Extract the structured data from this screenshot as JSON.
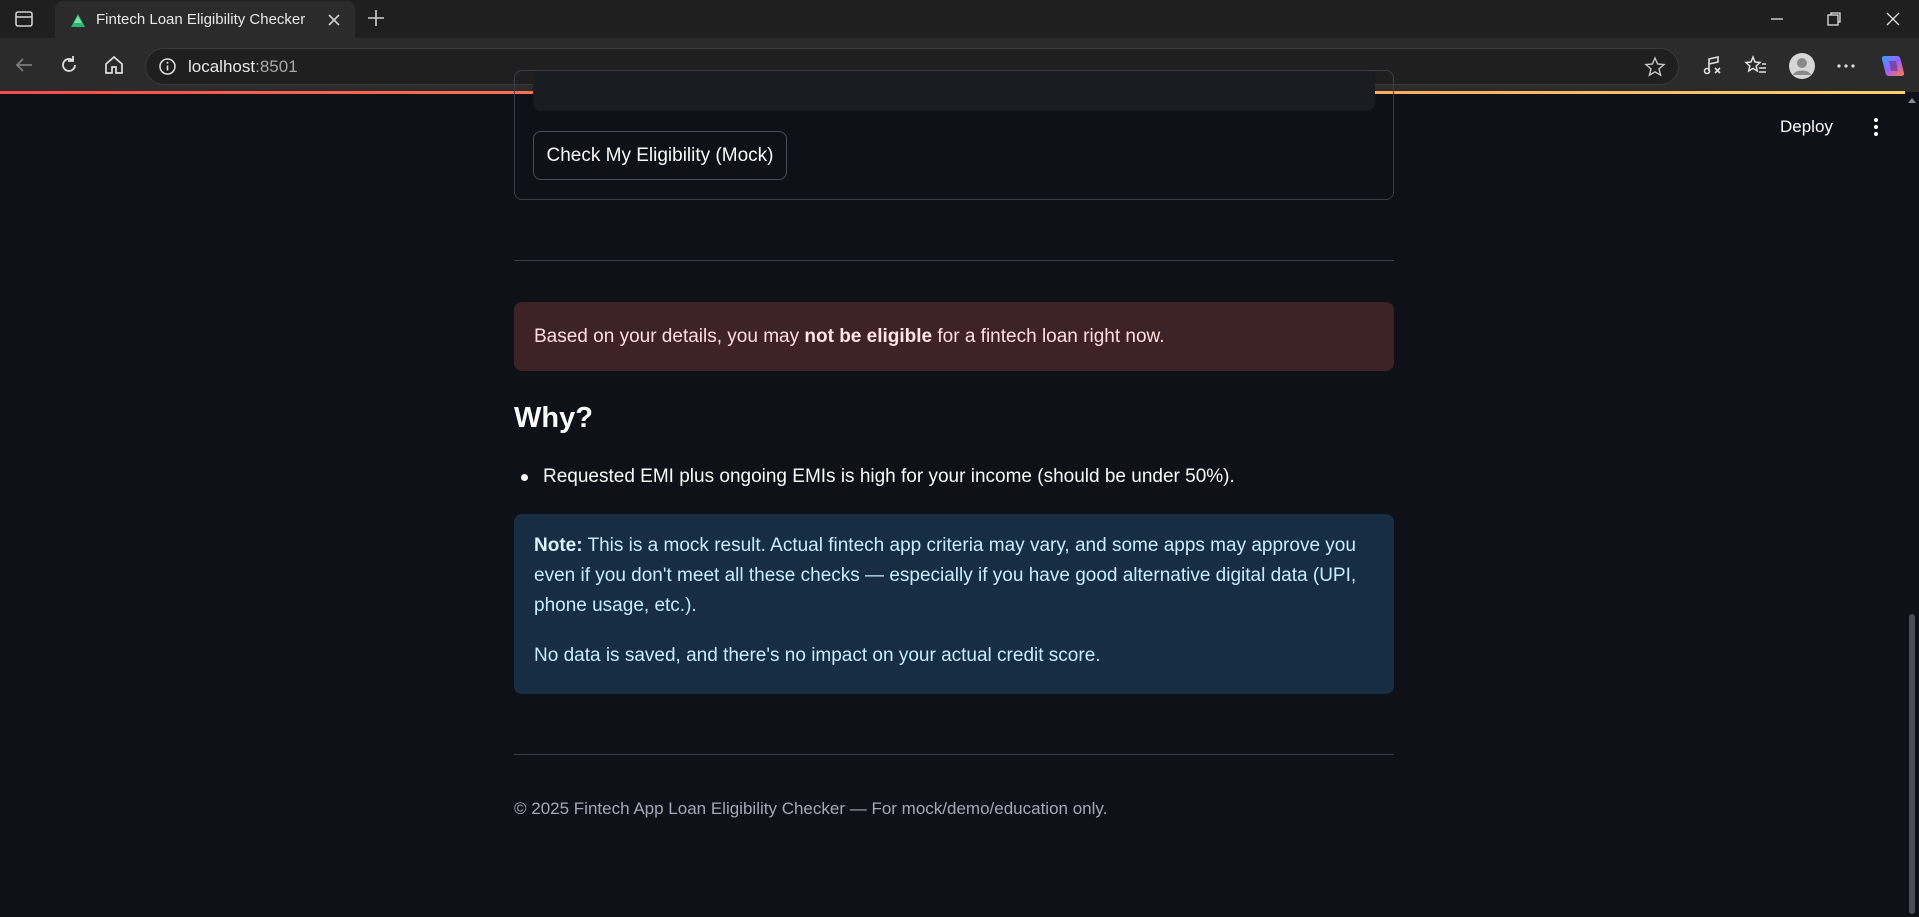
{
  "browser": {
    "tab_title": "Fintech Loan Eligibility Checker",
    "url_host": "localhost",
    "url_port": ":8501"
  },
  "app": {
    "deploy_label": "Deploy",
    "check_button_label": "Check My Eligibility (Mock)",
    "result": {
      "prefix": "Based on your details, you may ",
      "emphasis": "not be eligible",
      "suffix": " for a fintech loan right now."
    },
    "why_heading": "Why?",
    "reasons": [
      "Requested EMI plus ongoing EMIs is high for your income (should be under 50%)."
    ],
    "note": {
      "label": "Note:",
      "text": " This is a mock result. Actual fintech app criteria may vary, and some apps may approve you even if you don't meet all these checks — especially if you have good alternative digital data (UPI, phone usage, etc.).",
      "privacy": "No data is saved, and there's no impact on your actual credit score."
    },
    "footer": "© 2025 Fintech App Loan Eligibility Checker — For mock/demo/education only."
  },
  "colors": {
    "background": "#0e1117",
    "error_bg": "#3e2326",
    "info_bg": "#172d43"
  }
}
